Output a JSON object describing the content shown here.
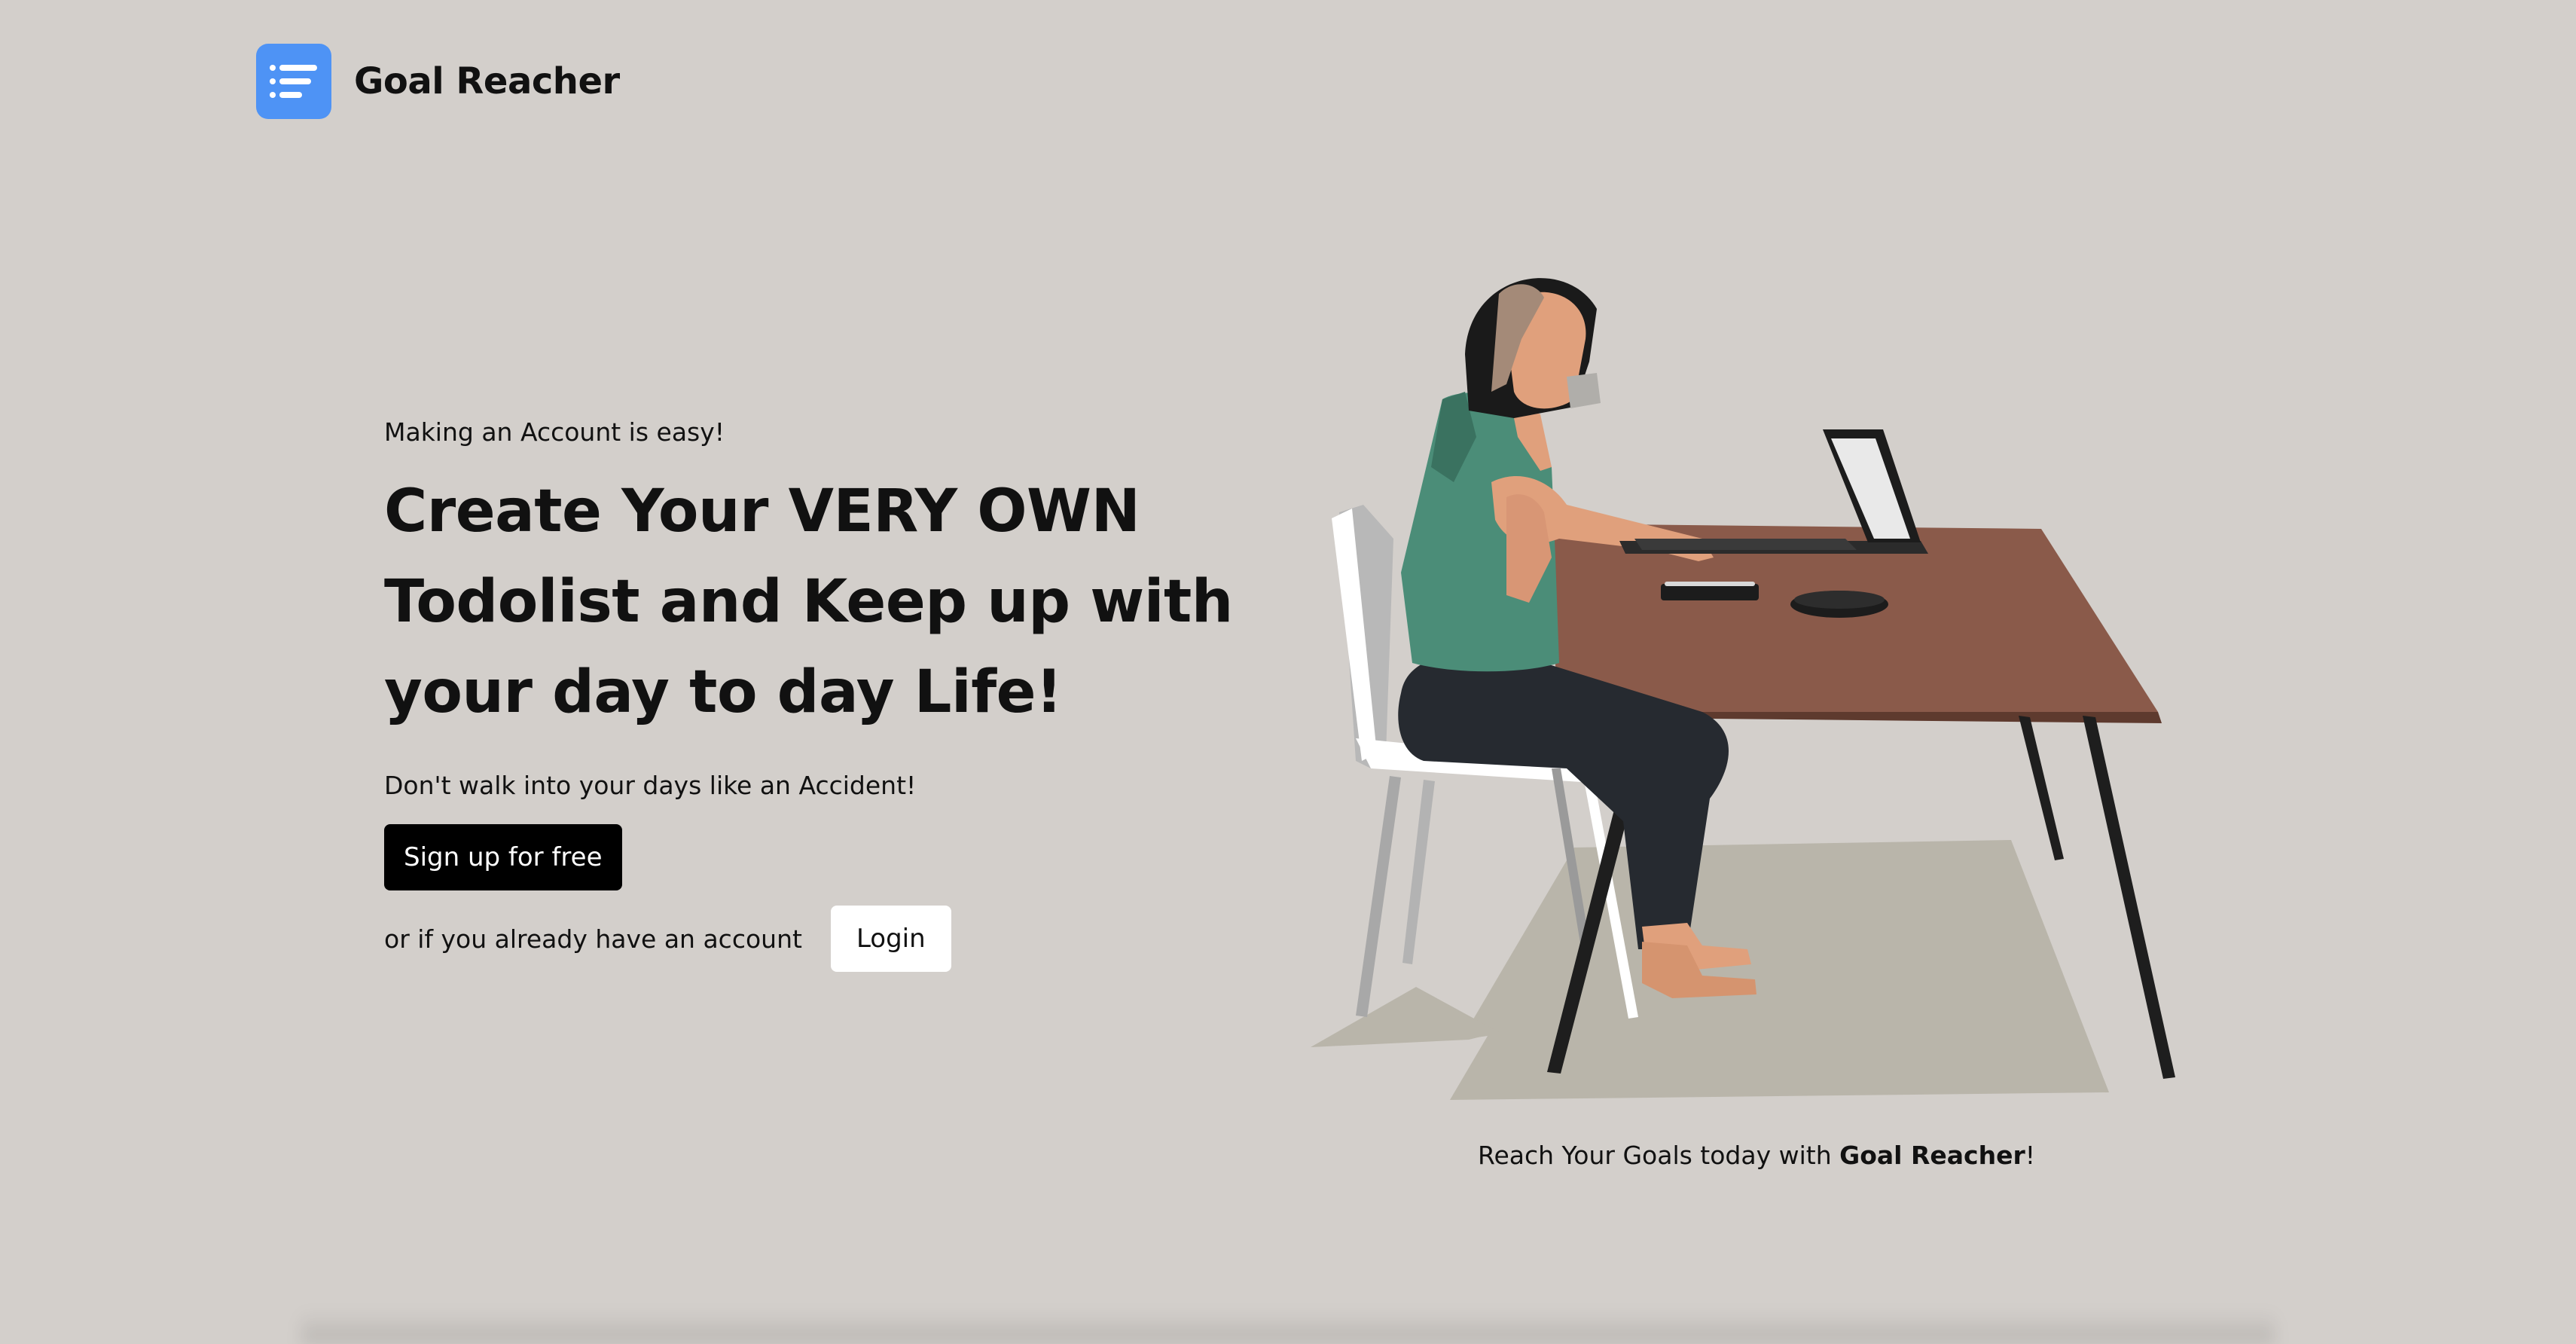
{
  "brand": {
    "name": "Goal Reacher",
    "logo_icon": "list-icon",
    "logo_color": "#4e93f5"
  },
  "hero": {
    "eyebrow": "Making an Account is easy!",
    "headline_lines": [
      "Create Your VERY OWN",
      "Todolist and Keep up with",
      "your day to day Life!"
    ],
    "subline": "Don't walk into your days like an Accident!",
    "signup_label": "Sign up for free",
    "login_prompt": "or if you already have an account",
    "login_label": "Login"
  },
  "illustration": {
    "icon": "woman-at-desk-illustration"
  },
  "caption": {
    "prefix": "Reach Your Goals today with ",
    "brand": "Goal Reacher",
    "suffix": "!"
  },
  "colors": {
    "background": "#d3cfcb",
    "primary_button": "#000000",
    "secondary_button": "#ffffff"
  }
}
